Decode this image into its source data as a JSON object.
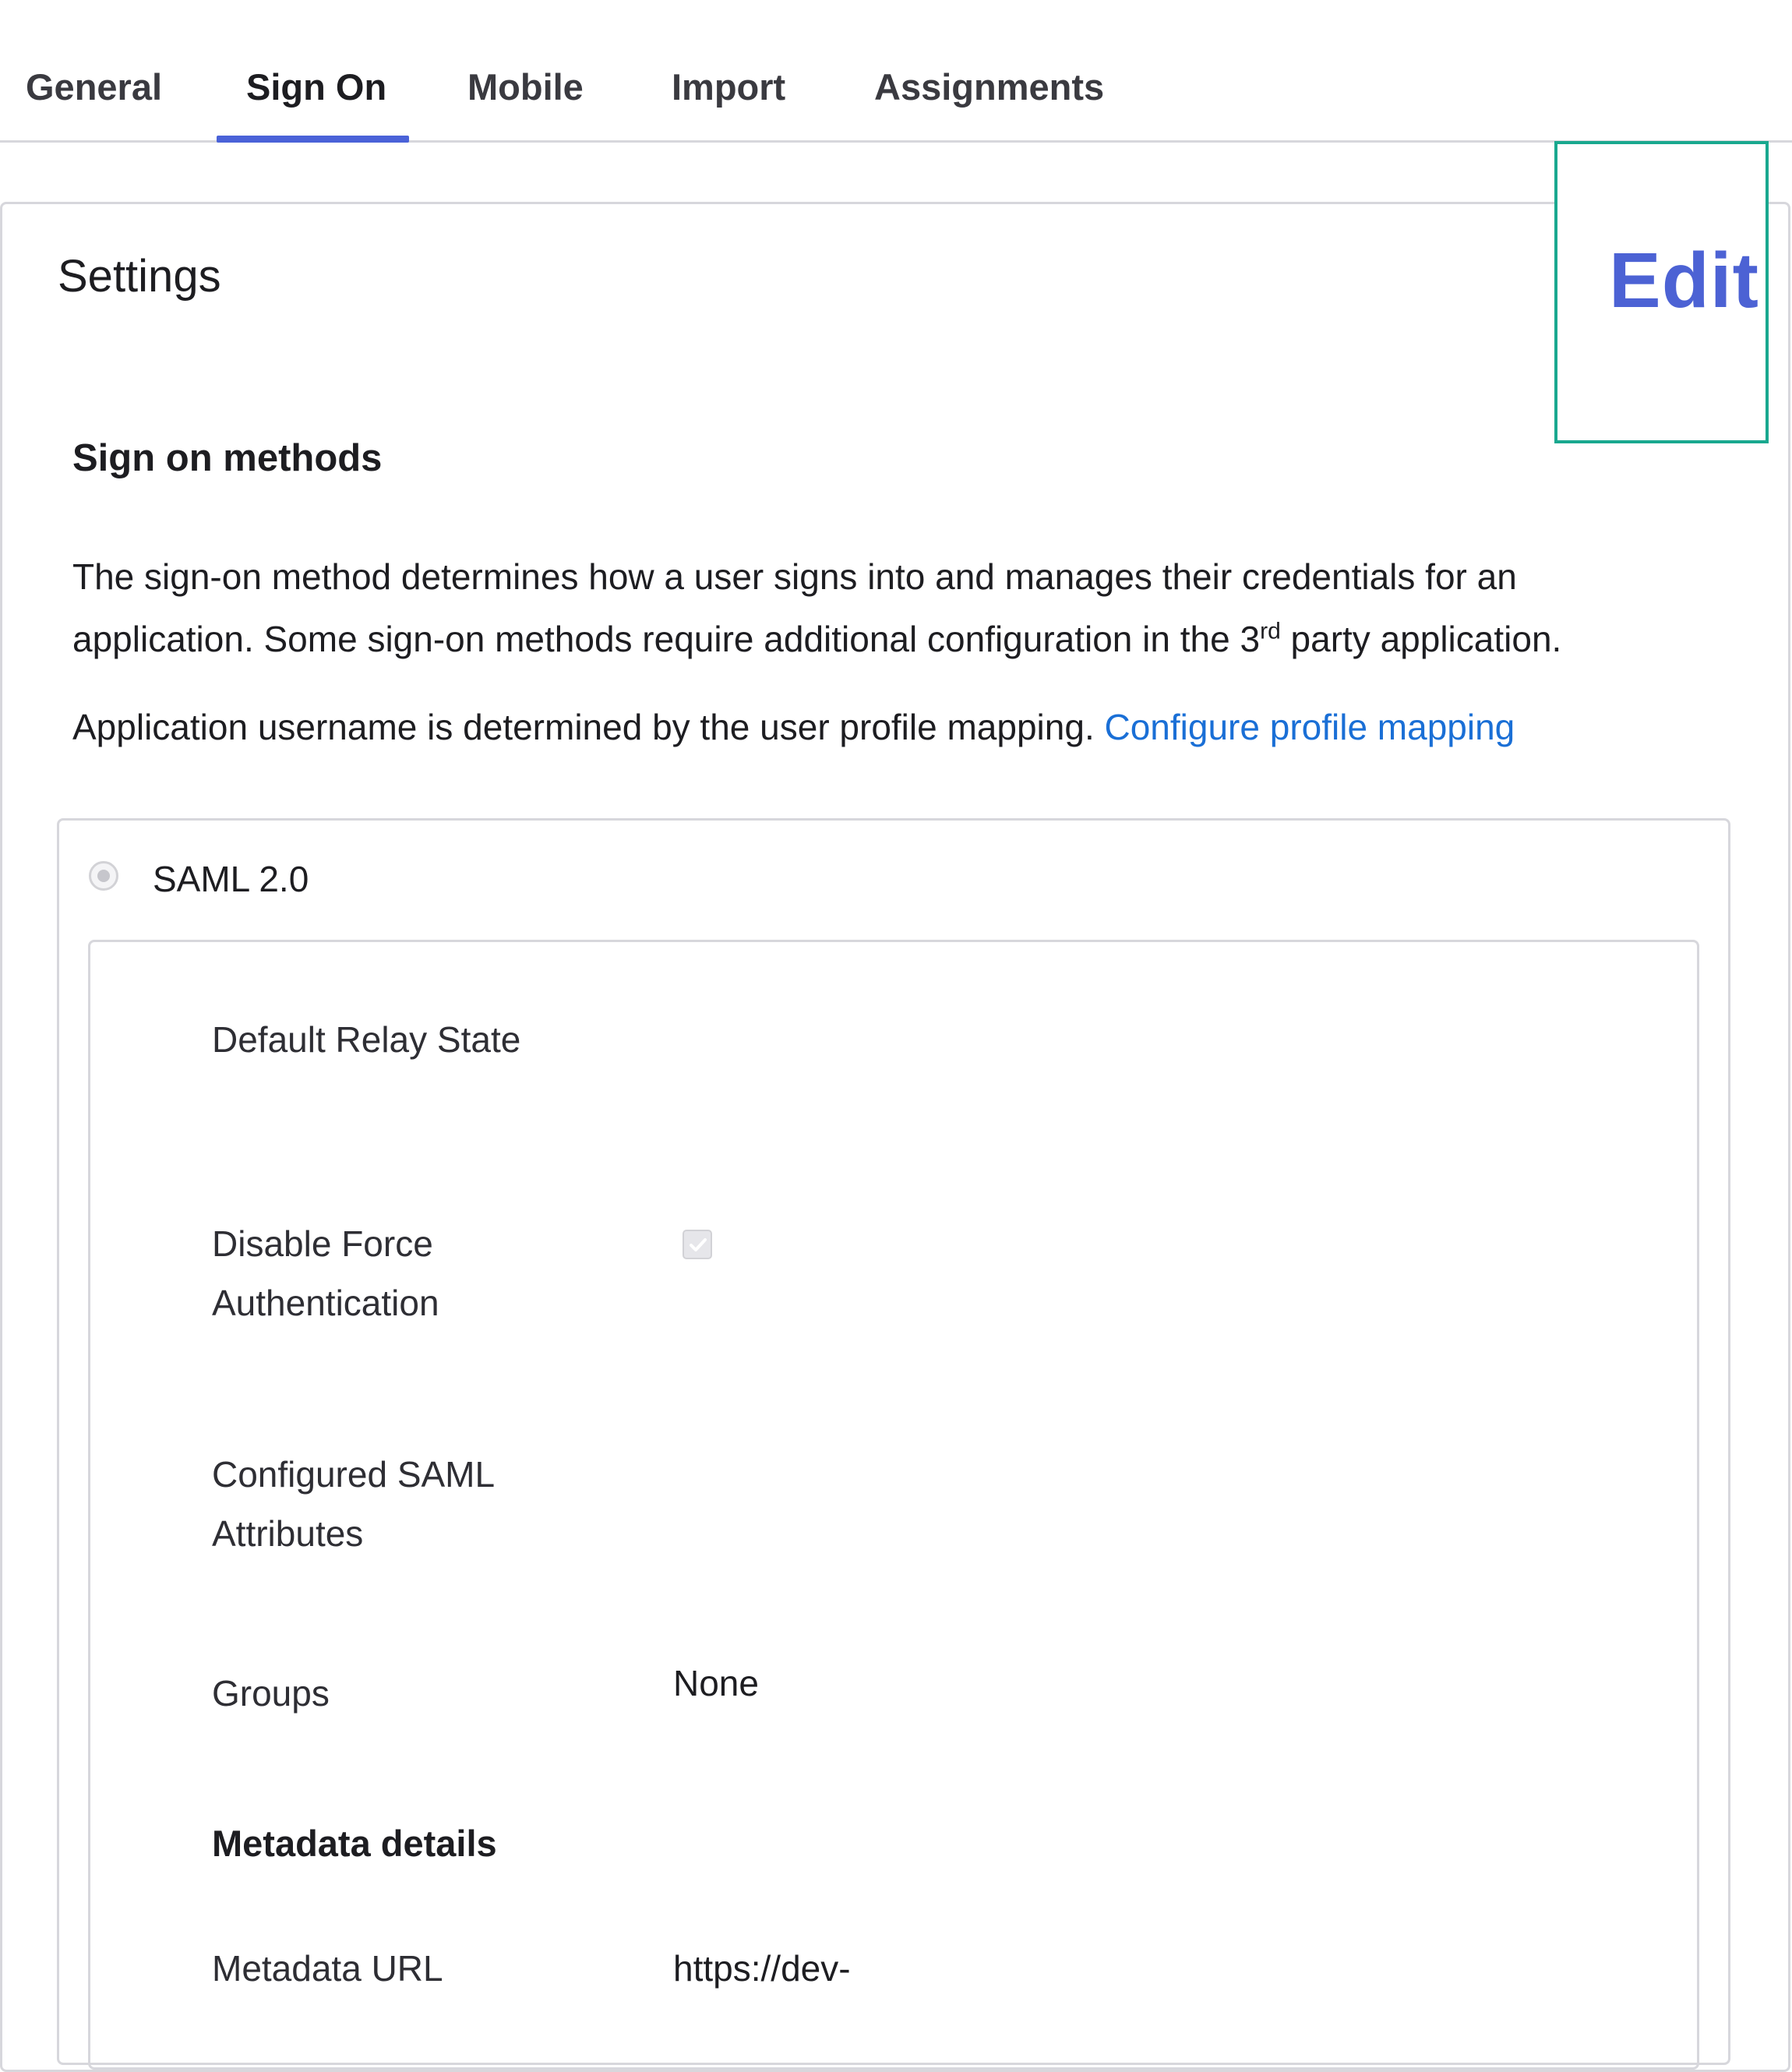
{
  "tabs": {
    "general": "General",
    "sign_on": "Sign On",
    "mobile": "Mobile",
    "import": "Import",
    "assignments": "Assignments"
  },
  "settings": {
    "title": "Settings",
    "edit_label": "Edit"
  },
  "sign_on_methods": {
    "heading": "Sign on methods",
    "description_1": "The sign-on method determines how a user signs into and manages their credentials for an",
    "description_2_pre": "application. Some sign-on methods require additional configuration in the 3",
    "description_2_sup": "rd",
    "description_2_post": " party application.",
    "username_text": "Application username is determined by the user profile mapping. ",
    "profile_mapping_link": "Configure profile mapping"
  },
  "method": {
    "label": "SAML 2.0",
    "selected": true
  },
  "fields": {
    "default_relay_state_label": "Default Relay State",
    "default_relay_state_value": "",
    "disable_force_auth_label_1": "Disable Force",
    "disable_force_auth_label_2": "Authentication",
    "disable_force_auth_checked": true,
    "configured_saml_attrs_label_1": "Configured SAML",
    "configured_saml_attrs_label_2": "Attributes",
    "groups_label": "Groups",
    "groups_value": "None"
  },
  "metadata": {
    "heading": "Metadata details",
    "url_label": "Metadata URL",
    "url_value": "https://dev-"
  },
  "colors": {
    "accent": "#4a62d8",
    "link": "#1a6fd6",
    "highlight_frame": "#19a88f"
  }
}
